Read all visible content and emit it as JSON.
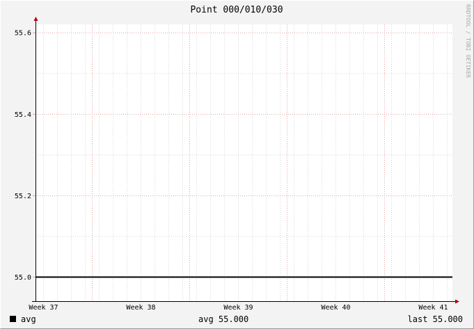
{
  "chart_data": {
    "type": "line",
    "title": "Point 000/010/030",
    "x_tick_labels": [
      "Week 37",
      "Week 38",
      "Week 39",
      "Week 40",
      "Week 41"
    ],
    "x_minor_per_major": 6,
    "y_range": [
      54.94,
      55.62
    ],
    "y_ticks": [
      55.0,
      55.2,
      55.4,
      55.6
    ],
    "y_tick_labels": [
      "55.0",
      "55.2",
      "55.4",
      "55.6"
    ],
    "y_minor_ticks": [
      55.1,
      55.3,
      55.5
    ],
    "grid": true,
    "series": [
      {
        "name": "avg",
        "color": "#000000",
        "x": [
          0,
          1
        ],
        "values": [
          55.0,
          55.0
        ]
      }
    ],
    "legend": {
      "entries": [
        "avg"
      ],
      "summary_avg": "avg 55.000",
      "summary_last": "last 55.000",
      "placement": "bottom"
    },
    "watermark": "RRDTOOL / TOBI OETIKER"
  },
  "colors": {
    "canvas": "#f3f3f3",
    "plot_background": "#ffffff",
    "major_grid": "#e4a0a0",
    "minor_grid": "#d6d6d6",
    "axis": "#000000",
    "axis_arrow": "#b00000",
    "frame_light": "#ffffff",
    "frame_dark": "#9a9a9a",
    "watermark": "#a8a8a8"
  }
}
